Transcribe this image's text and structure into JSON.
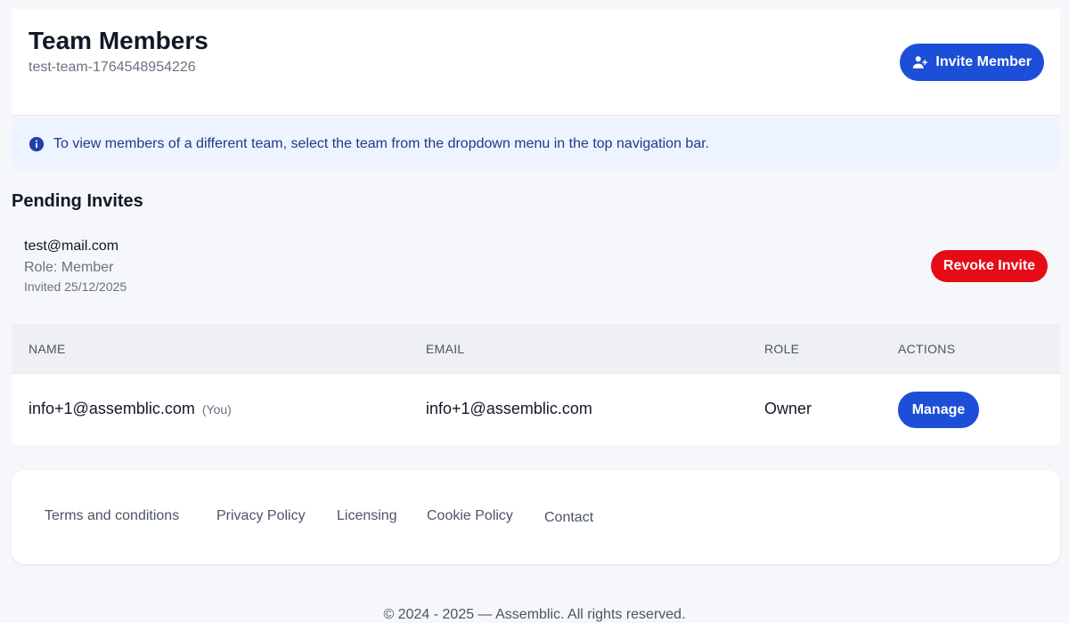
{
  "header": {
    "title": "Team Members",
    "team_name": "test-team-1764548954226",
    "invite_button": "Invite Member",
    "invite_icon": "user-plus-icon"
  },
  "info_banner": {
    "icon": "info-icon",
    "text": "To view members of a different team, select the team from the dropdown menu in the top navigation bar."
  },
  "pending": {
    "heading": "Pending Invites",
    "invites": [
      {
        "email": "test@mail.com",
        "role": "Role: Member",
        "invited": "Invited 25/12/2025",
        "revoke_label": "Revoke Invite"
      }
    ]
  },
  "table": {
    "columns": [
      "NAME",
      "EMAIL",
      "ROLE",
      "ACTIONS"
    ],
    "rows": [
      {
        "name": "info+1@assemblic.com",
        "you": "(You)",
        "email": "info+1@assemblic.com",
        "role": "Owner",
        "action": "Manage"
      }
    ]
  },
  "footer": {
    "links": [
      "Terms and conditions",
      "Privacy Policy",
      "Licensing",
      "Cookie Policy",
      "Contact"
    ],
    "copyright": "© 2024 - 2025 — Assemblic. All rights reserved."
  },
  "colors": {
    "primary": "#1d4ed8",
    "danger": "#e60b17",
    "info_bg": "#eef4ff"
  }
}
